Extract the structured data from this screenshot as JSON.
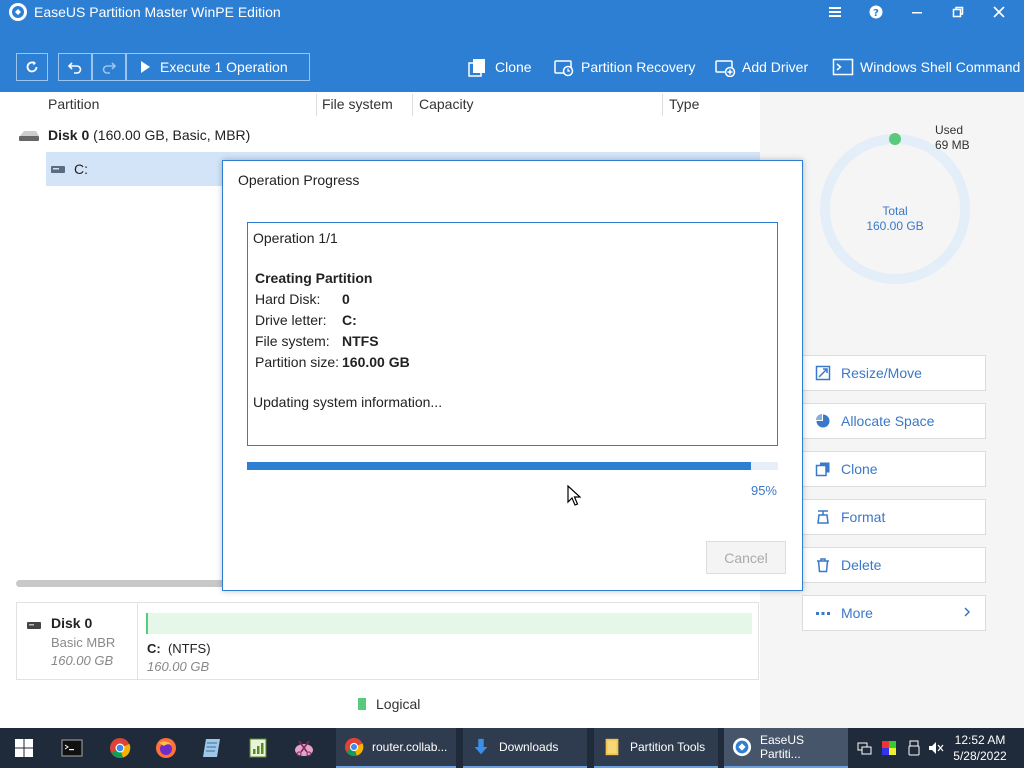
{
  "window": {
    "title": "EaseUS Partition Master WinPE Edition"
  },
  "toolbar": {
    "execute_label": "Execute 1 Operation",
    "clone_label": "Clone",
    "partition_recovery_label": "Partition Recovery",
    "add_driver_label": "Add Driver",
    "windows_shell_label": "Windows Shell Command"
  },
  "table": {
    "columns": [
      "Partition",
      "File system",
      "Capacity",
      "Type"
    ],
    "disk_label": "Disk 0",
    "disk_info": "(160.00 GB, Basic, MBR)",
    "partition": "C:"
  },
  "disk_map": {
    "name": "Disk 0",
    "type": "Basic MBR",
    "size": "160.00 GB",
    "partition_letter": "C:",
    "partition_fs": "(NTFS)",
    "partition_size": "160.00 GB"
  },
  "legend": {
    "logical": "Logical"
  },
  "usage": {
    "used_label": "Used",
    "used_value": "69 MB",
    "total_label": "Total",
    "total_value": "160.00 GB"
  },
  "actions": [
    {
      "label": "Resize/Move",
      "icon": "resize-icon"
    },
    {
      "label": "Allocate Space",
      "icon": "pie-icon"
    },
    {
      "label": "Clone",
      "icon": "clone-icon"
    },
    {
      "label": "Format",
      "icon": "format-icon"
    },
    {
      "label": "Delete",
      "icon": "trash-icon"
    },
    {
      "label": "More",
      "icon": "more-icon"
    }
  ],
  "dialog": {
    "title": "Operation Progress",
    "operation_counter": "Operation 1/1",
    "operation_name": "Creating Partition",
    "fields": [
      {
        "key": "Hard Disk:",
        "value": "0"
      },
      {
        "key": "Drive letter:",
        "value": "C:"
      },
      {
        "key": "File system:",
        "value": "NTFS"
      },
      {
        "key": "Partition size:",
        "value": "160.00 GB"
      }
    ],
    "status": "Updating system information...",
    "progress": 95,
    "progress_label": "95%",
    "cancel_label": "Cancel"
  },
  "taskbar": {
    "tasks": [
      {
        "label": "router.collab..."
      },
      {
        "label": "Downloads"
      },
      {
        "label": "Partition Tools"
      },
      {
        "label": "EaseUS Partiti..."
      }
    ],
    "time": "12:52 AM",
    "date": "5/28/2022"
  },
  "colors": {
    "accent": "#2d7fd3",
    "logical_green": "#59c97b",
    "link_blue": "#3a78c8"
  }
}
